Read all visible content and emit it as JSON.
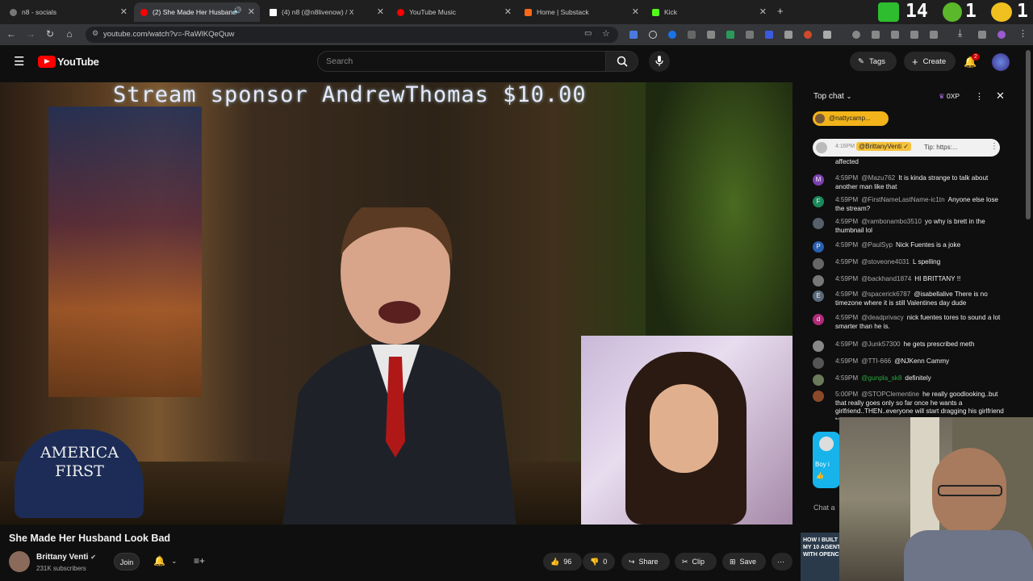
{
  "browser": {
    "tabs": [
      {
        "label": "n8 - socials",
        "color": "#777"
      },
      {
        "label": "(2) She Made Her Husband",
        "color": "#ff0000",
        "active": true
      },
      {
        "label": "(4) n8 (@n8livenow) / X",
        "color": "#ffffff"
      },
      {
        "label": "YouTube Music",
        "color": "#ff0000"
      },
      {
        "label": "Home | Substack",
        "color": "#ff6719"
      },
      {
        "label": "Kick",
        "color": "#53fc18"
      }
    ],
    "new_tab": "+",
    "url": "youtube.com/watch?v=-RaWlKQeQuw",
    "counter_a": "14",
    "counter_b": "1",
    "counter_c": "1"
  },
  "youtube": {
    "logo_text": "YouTube",
    "search_placeholder": "Search",
    "tags_label": "Tags",
    "create_label": "Create",
    "notif_count": "2"
  },
  "video": {
    "sponsor_text": "Stream sponsor AndrewThomas  $10.00",
    "hat_text": "AMERICA FIRST",
    "progress": 0.02
  },
  "meta": {
    "title": "She Made Her Husband Look Bad",
    "channel": "Brittany Venti",
    "subscribers": "231K subscribers",
    "join_label": "Join",
    "like_count": "96",
    "dislike_count": "0",
    "share_label": "Share",
    "clip_label": "Clip",
    "save_label": "Save"
  },
  "chat": {
    "header": "Top chat",
    "xp_label": "0XP",
    "pinned_user": "@nattycamp...",
    "pinned_msg": {
      "time": "4:16PM",
      "user": "@BrittanyVenti ✓",
      "text": "Tip: https:..."
    },
    "first_fragment": "affected",
    "messages": [
      {
        "time": "4:59PM",
        "user": "@Mazu762",
        "text": "It is kinda strange to talk about another man like that",
        "color": "#7b3fb0",
        "initial": "M"
      },
      {
        "time": "4:59PM",
        "user": "@FirstNameLastName-ic1tn",
        "text": "Anyone else lose the stream?",
        "color": "#1a8a5a",
        "initial": "F"
      },
      {
        "time": "4:59PM",
        "user": "@rambonambo3510",
        "text": "yo why is brett in the thumbnail lol",
        "color": "#55606a",
        "initial": ""
      },
      {
        "time": "4:59PM",
        "user": "@PaulSyp",
        "text": "Nick Fuentes is a joke",
        "color": "#2a5fb0",
        "initial": "P"
      },
      {
        "time": "4:59PM",
        "user": "@stoveone4031",
        "text": "L spelling",
        "color": "#666",
        "initial": ""
      },
      {
        "time": "4:59PM",
        "user": "@backhand1874",
        "text": "HI BRITTANY !!",
        "color": "#777",
        "initial": ""
      },
      {
        "time": "4:59PM",
        "user": "@spacerick6787",
        "text": "@isabellalive There is no timezone where it is still Valentines day dude",
        "color": "#5a6a7a",
        "initial": "E"
      },
      {
        "time": "4:59PM",
        "user": "@deadprivacy",
        "text": "nick fuentes tores to sound a lot smarter than he is.",
        "color": "#b02a7a",
        "initial": "d"
      },
      {
        "time": "4:59PM",
        "user": "@Junk57300",
        "text": "he gets prescribed meth",
        "color": "#888",
        "initial": ""
      },
      {
        "time": "4:59PM",
        "user": "@TTI-666",
        "text": "@NJKenn Cammy",
        "color": "#555",
        "initial": ""
      },
      {
        "time": "4:59PM",
        "user": "@gunpla_sk8",
        "text": "definitely",
        "color": "#6a7a5a",
        "initial": "",
        "member": true
      },
      {
        "time": "5:00PM",
        "user": "@STOPClementine",
        "text": "he really goodlooking..but that really goes only so far once he wants a girlfriend..THEN..everyone will start dragging his girlfriend to TRIGGER him. its a vi...",
        "color": "#8a4a2a",
        "initial": ""
      }
    ],
    "card_text": "Boy i",
    "chat_placeholder": "Chat a"
  },
  "thumbnail_text": "HOW I BUILT MY 10 AGENT WITH OPENC"
}
